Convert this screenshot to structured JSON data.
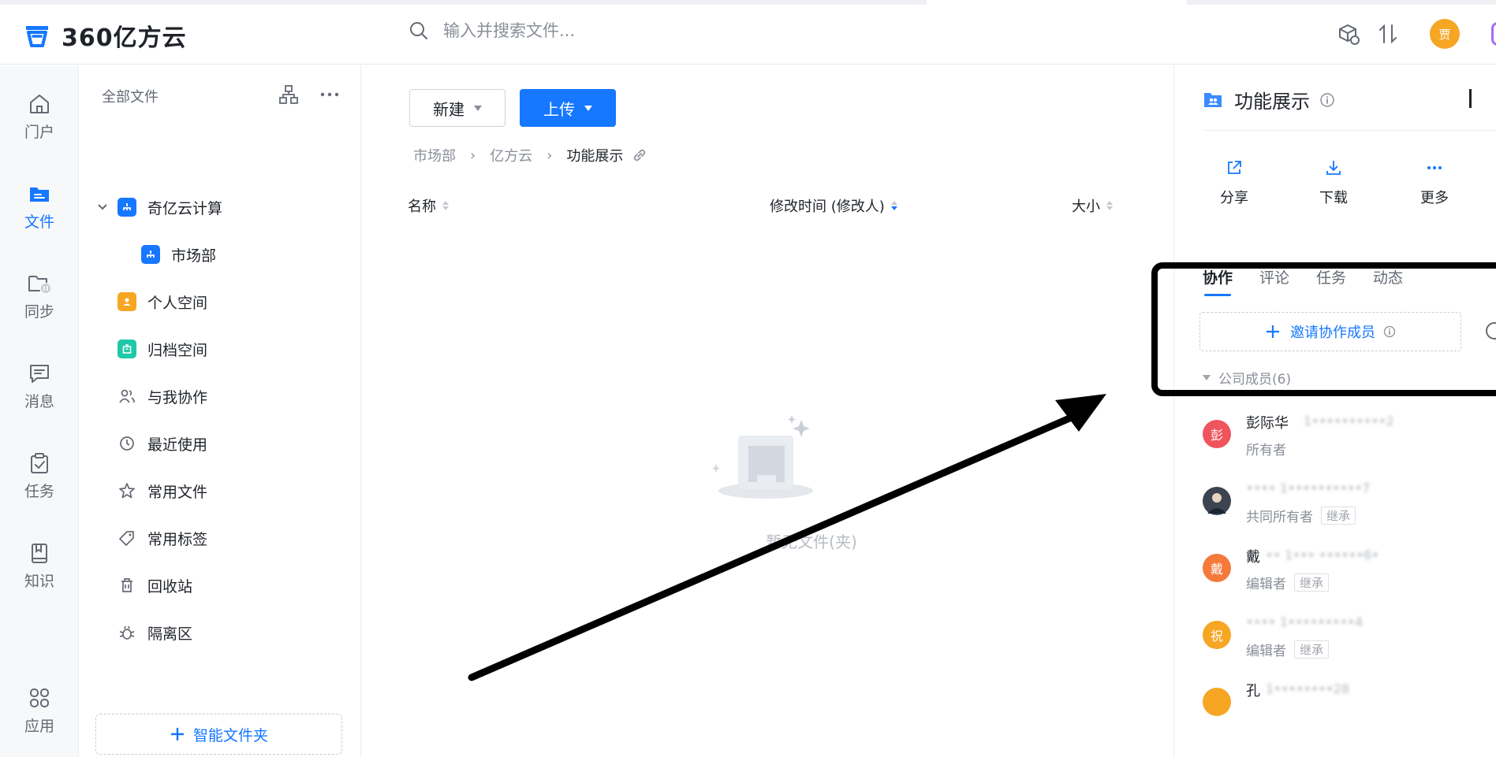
{
  "app": {
    "logo_text": "360亿方云"
  },
  "search": {
    "placeholder": "输入并搜索文件..."
  },
  "header": {
    "user_avatar_text": "贾"
  },
  "leftnav": {
    "items": [
      {
        "label": "门户"
      },
      {
        "label": "文件"
      },
      {
        "label": "同步"
      },
      {
        "label": "消息"
      },
      {
        "label": "任务"
      },
      {
        "label": "知识"
      },
      {
        "label": "应用"
      }
    ]
  },
  "tree": {
    "title": "全部文件",
    "items": [
      {
        "label": "奇亿云计算"
      },
      {
        "label": "市场部"
      },
      {
        "label": "个人空间"
      },
      {
        "label": "归档空间"
      },
      {
        "label": "与我协作"
      },
      {
        "label": "最近使用"
      },
      {
        "label": "常用文件"
      },
      {
        "label": "常用标签"
      },
      {
        "label": "回收站"
      },
      {
        "label": "隔离区"
      }
    ],
    "smart_folder_label": "智能文件夹"
  },
  "toolbar": {
    "new_label": "新建",
    "upload_label": "上传"
  },
  "breadcrumb": {
    "items": [
      "市场部",
      "亿方云",
      "功能展示"
    ]
  },
  "table": {
    "columns": [
      "名称",
      "修改时间 (修改人)",
      "大小"
    ]
  },
  "empty": {
    "text": "暂无文件(夹)"
  },
  "panel": {
    "title": "功能展示",
    "actions": [
      {
        "label": "分享"
      },
      {
        "label": "下载"
      },
      {
        "label": "更多"
      }
    ],
    "tabs": [
      {
        "label": "协作"
      },
      {
        "label": "评论"
      },
      {
        "label": "任务"
      },
      {
        "label": "动态"
      }
    ],
    "invite_label": "邀请协作成员",
    "group_label": "公司成员(6)",
    "members": [
      {
        "avatar": "彭",
        "name": "彭际华",
        "role": "所有者",
        "tag": "",
        "color": "#f0545d"
      },
      {
        "avatar": "",
        "name": "",
        "role": "共同所有者",
        "tag": "继承",
        "color": "#3b4450"
      },
      {
        "avatar": "戴",
        "name": "戴",
        "role": "编辑者",
        "tag": "继承",
        "color": "#f5793b"
      },
      {
        "avatar": "祝",
        "name": "",
        "role": "编辑者",
        "tag": "继承",
        "color": "#f6a623"
      },
      {
        "avatar": "",
        "name": "孔",
        "role": "",
        "tag": "",
        "color": "#f6a623"
      }
    ]
  },
  "colors": {
    "accent": "#1677ff"
  }
}
